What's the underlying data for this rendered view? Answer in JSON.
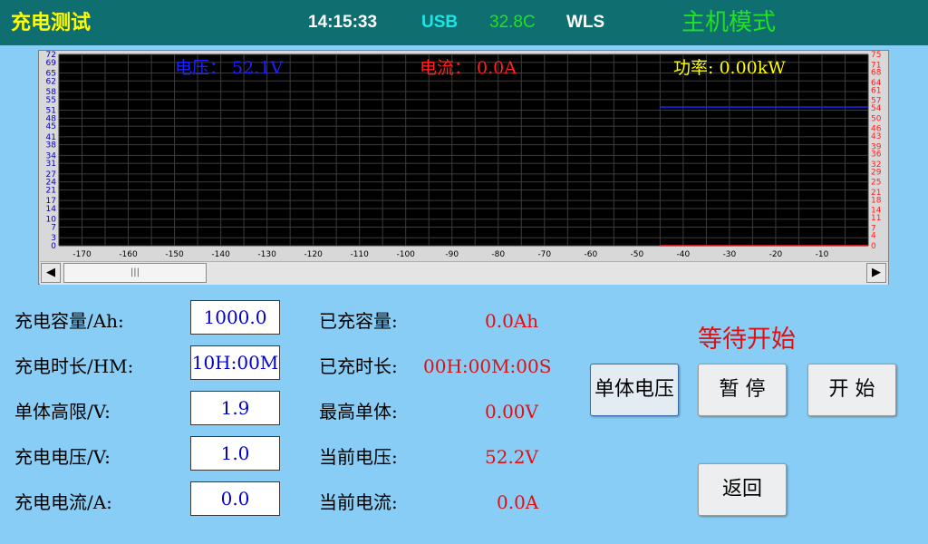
{
  "header": {
    "title": "充电测试",
    "time": "14:15:33",
    "usb": "USB",
    "temperature": "32.8C",
    "wireless": "WLS",
    "mode": "主机模式"
  },
  "chart_data": {
    "type": "line",
    "readouts": {
      "voltage": "电压：  52.1V",
      "current": "电流：   0.0A",
      "power": "功率: 0.00kW"
    },
    "x_ticks": [
      -170,
      -160,
      -150,
      -140,
      -130,
      -120,
      -110,
      -100,
      -90,
      -80,
      -70,
      -60,
      -50,
      -40,
      -30,
      -20,
      -10
    ],
    "y_left_ticks": [
      0,
      3,
      7,
      10,
      14,
      17,
      21,
      24,
      27,
      31,
      34,
      38,
      41,
      45,
      48,
      51,
      55,
      58,
      62,
      65,
      69,
      72
    ],
    "y_right_ticks": [
      0,
      4,
      7,
      11,
      14,
      18,
      21,
      25,
      29,
      32,
      36,
      39,
      43,
      46,
      50,
      54,
      57,
      61,
      64,
      68,
      71,
      75
    ],
    "xlim": [
      -175,
      0
    ],
    "ylim_left": [
      0,
      72
    ],
    "ylim_right": [
      0,
      75
    ],
    "grid": true,
    "series": [
      {
        "color": "#2020ff",
        "x": [
          -45,
          0
        ],
        "y": [
          52.2,
          52.2
        ]
      },
      {
        "color": "#ff2020",
        "x": [
          -45,
          0
        ],
        "y": [
          0,
          0
        ]
      }
    ],
    "colors": {
      "background": "#000000",
      "grid": "#3c3c3c",
      "voltage": "#2020ff",
      "current": "#ff2020",
      "power": "#ffff00",
      "right_axis": "#ff2020"
    }
  },
  "scrollbar": {
    "left_arrow": "◀",
    "right_arrow": "▶",
    "thumb_grip": "|||"
  },
  "settings": [
    {
      "label": "充电容量/Ah:",
      "value": "1000.0"
    },
    {
      "label": "充电时长/HM:",
      "value": "10H:00M"
    },
    {
      "label": "单体高限/V:",
      "value": "1.9"
    },
    {
      "label": "充电电压/V:",
      "value": "1.0"
    },
    {
      "label": "充电电流/A:",
      "value": "0.0"
    }
  ],
  "readings": [
    {
      "label": "已充容量:",
      "value": "0.0Ah"
    },
    {
      "label": "已充时长:",
      "value": "00H:00M:00S"
    },
    {
      "label": "最高单体:",
      "value": "0.00V"
    },
    {
      "label": "当前电压:",
      "value": "52.2V"
    },
    {
      "label": "当前电流:",
      "value": "0.0A"
    }
  ],
  "status": "等待开始",
  "buttons": {
    "cell_voltage": "单体电压",
    "pause": "暂 停",
    "start": "开 始",
    "back": "返回"
  }
}
